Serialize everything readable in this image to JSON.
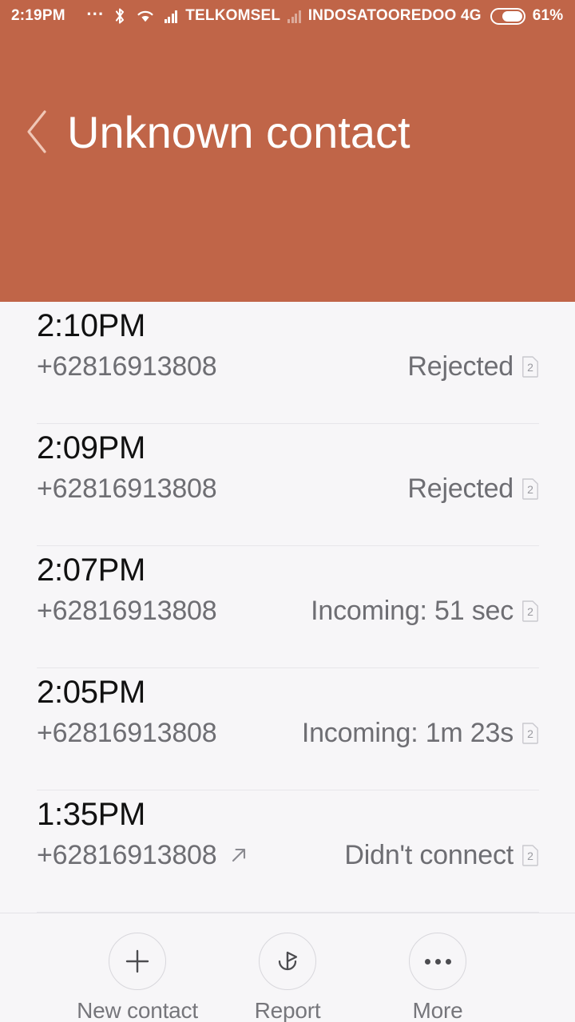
{
  "status_bar": {
    "clock": "2:19PM",
    "overflow_icon": "more-dots-icon",
    "bluetooth_icon": "bluetooth-icon",
    "wifi_icon": "wifi-icon",
    "signal1_icon": "signal-bars-icon",
    "carrier1": "TELKOMSEL",
    "signal2_icon": "signal-bars-icon",
    "carrier2": "INDOSATOOREDOO 4G",
    "battery_icon": "battery-icon",
    "battery_percent": "61%",
    "battery_level": 61,
    "background_color": "#C06548",
    "text_color": "#FFFFFF"
  },
  "header": {
    "back_icon": "back-chevron-icon",
    "title": "Unknown contact",
    "background_color": "#C06548",
    "title_color": "#FFFFFF"
  },
  "call_log": {
    "rows": [
      {
        "time": "2:10PM",
        "number": "+62816913808",
        "status": "Rejected",
        "sim": "2",
        "direction_icon": ""
      },
      {
        "time": "2:09PM",
        "number": "+62816913808",
        "status": "Rejected",
        "sim": "2",
        "direction_icon": ""
      },
      {
        "time": "2:07PM",
        "number": "+62816913808",
        "status": "Incoming: 51 sec",
        "sim": "2",
        "direction_icon": ""
      },
      {
        "time": "2:05PM",
        "number": "+62816913808",
        "status": "Incoming: 1m 23s",
        "sim": "2",
        "direction_icon": ""
      },
      {
        "time": "1:35PM",
        "number": "+62816913808",
        "status": "Didn't connect",
        "sim": "2",
        "direction_icon": "outgoing-call-arrow-icon"
      }
    ]
  },
  "bottom_bar": {
    "actions": [
      {
        "label": "New contact",
        "icon": "plus-icon"
      },
      {
        "label": "Report",
        "icon": "report-flag-icon"
      },
      {
        "label": "More",
        "icon": "more-dots-icon"
      }
    ]
  }
}
